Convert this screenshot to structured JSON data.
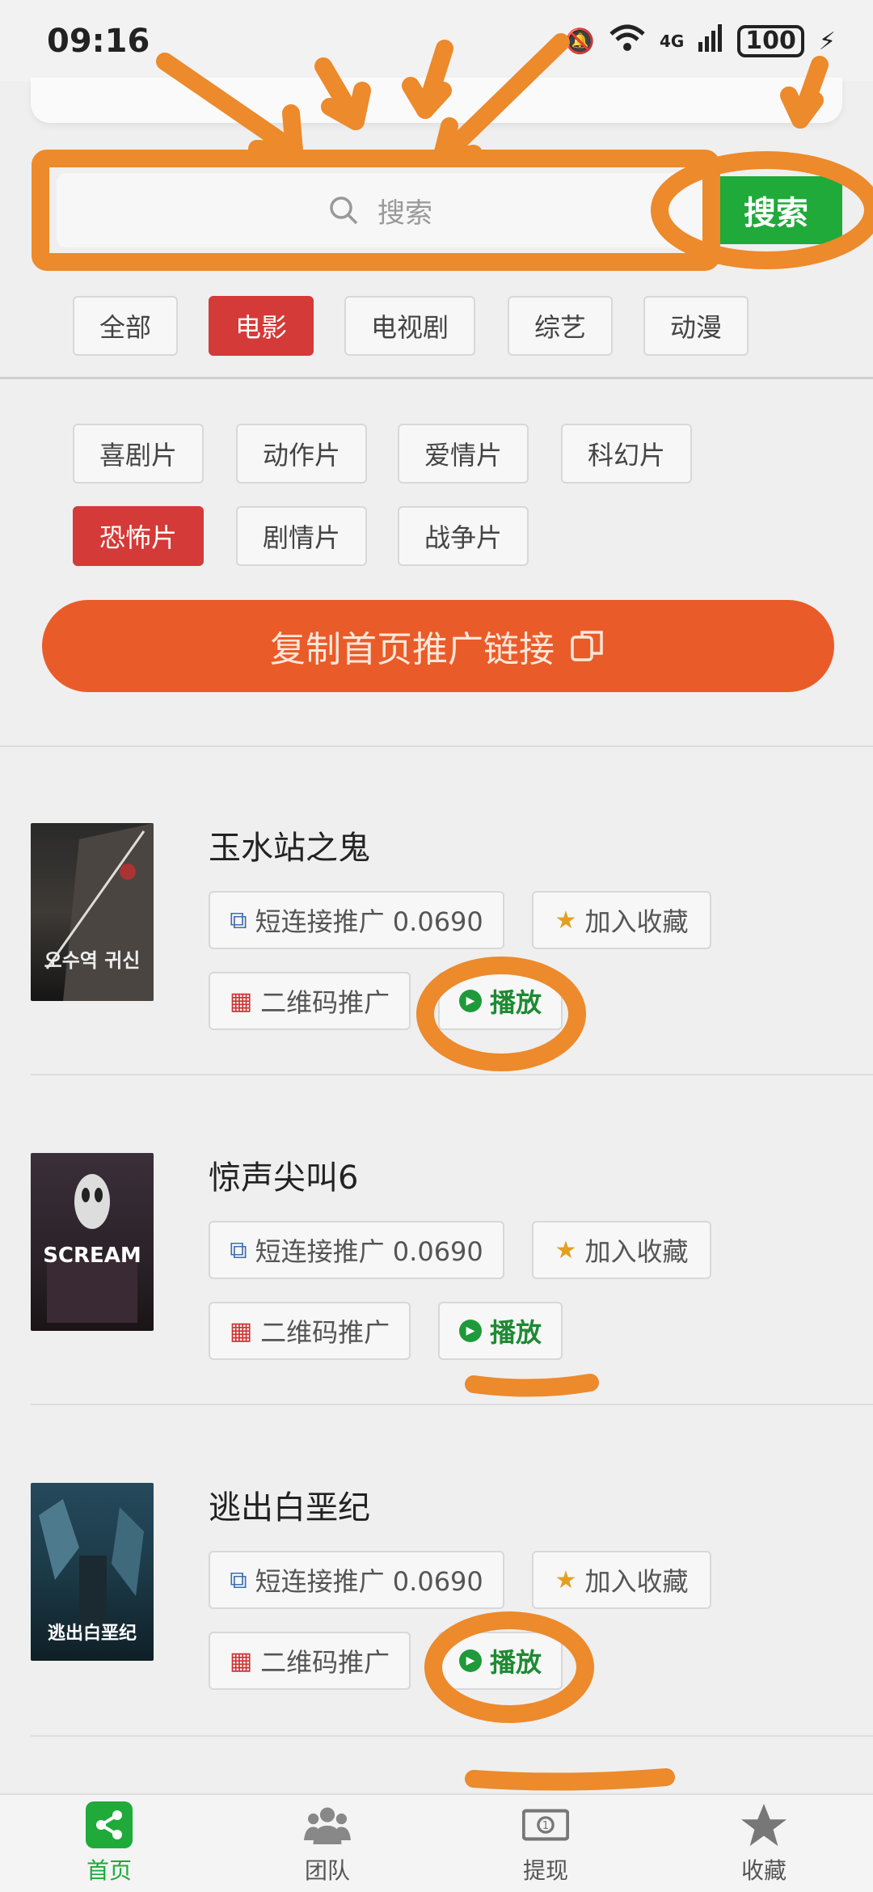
{
  "status_bar": {
    "time": "09:16",
    "network": "4G",
    "battery": "100"
  },
  "search": {
    "placeholder": "搜索",
    "button_label": "搜索"
  },
  "category_tabs": [
    {
      "label": "全部",
      "active": false
    },
    {
      "label": "电影",
      "active": true
    },
    {
      "label": "电视剧",
      "active": false
    },
    {
      "label": "综艺",
      "active": false
    },
    {
      "label": "动漫",
      "active": false
    }
  ],
  "genre_tags": [
    {
      "label": "喜剧片",
      "active": false
    },
    {
      "label": "动作片",
      "active": false
    },
    {
      "label": "爱情片",
      "active": false
    },
    {
      "label": "科幻片",
      "active": false
    },
    {
      "label": "恐怖片",
      "active": true
    },
    {
      "label": "剧情片",
      "active": false
    },
    {
      "label": "战争片",
      "active": false
    }
  ],
  "copy_button": {
    "label": "复制首页推广链接"
  },
  "movies": [
    {
      "title": "玉水站之鬼",
      "short_link_label": "短连接推广 0.0690",
      "favorite_label": "加入收藏",
      "qr_label": "二维码推广",
      "play_label": "播放",
      "poster_text": "오수역 귀신"
    },
    {
      "title": "惊声尖叫6",
      "short_link_label": "短连接推广 0.0690",
      "favorite_label": "加入收藏",
      "qr_label": "二维码推广",
      "play_label": "播放",
      "poster_text": "SCREAM"
    },
    {
      "title": "逃出白垩纪",
      "short_link_label": "短连接推广 0.0690",
      "favorite_label": "加入收藏",
      "qr_label": "二维码推广",
      "play_label": "播放",
      "poster_text": "逃出白垩纪"
    }
  ],
  "tabbar": [
    {
      "label": "首页",
      "icon": "share-icon",
      "active": true
    },
    {
      "label": "团队",
      "icon": "team-icon",
      "active": false
    },
    {
      "label": "提现",
      "icon": "cash-icon",
      "active": false
    },
    {
      "label": "收藏",
      "icon": "star-icon",
      "active": false
    }
  ],
  "colors": {
    "accent_green": "#1faa3a",
    "active_red": "#d43a38",
    "promo_orange": "#ea5b2a",
    "annotation_orange": "#ec8a2c"
  }
}
